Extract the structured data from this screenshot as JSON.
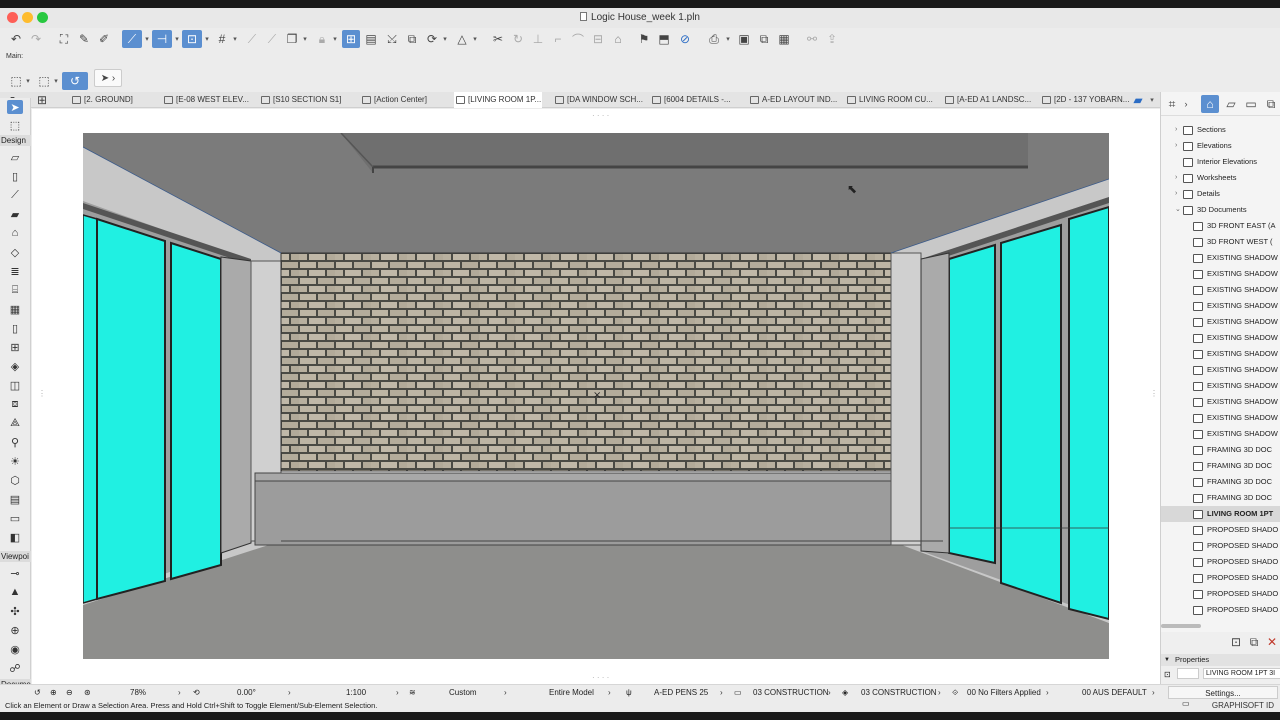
{
  "window": {
    "title": "Logic House_week 1.pln"
  },
  "colors": {
    "active_blue": "#5b8fd0",
    "glass": "#20f0e2",
    "ceiling": "#7b7b7b",
    "floor": "#8e8e8c",
    "brick": "#b8b0a0"
  },
  "main_label": "Main:",
  "tabs": [
    {
      "label": "[2. GROUND]"
    },
    {
      "label": "[E-08 WEST ELEV..."
    },
    {
      "label": "[S10 SECTION S1]"
    },
    {
      "label": "[Action Center]"
    },
    {
      "label": "[LIVING ROOM 1P..."
    },
    {
      "label": "[DA WINDOW SCH..."
    },
    {
      "label": "[6004 DETAILS -..."
    },
    {
      "label": "A-ED LAYOUT IND..."
    },
    {
      "label": "LIVING ROOM CU..."
    },
    {
      "label": "[A-ED A1 LANDSC..."
    },
    {
      "label": "[2D - 137 YOBARN..."
    }
  ],
  "toolbox": {
    "design_label": "Design",
    "viewpoint_label": "Viewpoi",
    "document_label": "Docume"
  },
  "navigator": {
    "items": [
      {
        "label": "Sections",
        "arrow": "›"
      },
      {
        "label": "Elevations",
        "arrow": "›"
      },
      {
        "label": "Interior Elevations",
        "arrow": ""
      },
      {
        "label": "Worksheets",
        "arrow": "›"
      },
      {
        "label": "Details",
        "arrow": "›"
      },
      {
        "label": "3D Documents",
        "arrow": "⌄"
      },
      {
        "label": "3D FRONT EAST (A"
      },
      {
        "label": "3D FRONT WEST ("
      },
      {
        "label": "EXISTING SHADOW"
      },
      {
        "label": "EXISTING SHADOW"
      },
      {
        "label": "EXISTING SHADOW"
      },
      {
        "label": "EXISTING SHADOW"
      },
      {
        "label": "EXISTING SHADOW"
      },
      {
        "label": "EXISTING SHADOW"
      },
      {
        "label": "EXISTING SHADOW"
      },
      {
        "label": "EXISTING SHADOW"
      },
      {
        "label": "EXISTING SHADOW"
      },
      {
        "label": "EXISTING SHADOW"
      },
      {
        "label": "EXISTING SHADOW"
      },
      {
        "label": "EXISTING SHADOW"
      },
      {
        "label": "FRAMING 3D DOC"
      },
      {
        "label": "FRAMING 3D DOC"
      },
      {
        "label": "FRAMING 3D DOC"
      },
      {
        "label": "FRAMING 3D DOC"
      },
      {
        "label": "LIVING ROOM 1PT"
      },
      {
        "label": "PROPOSED SHADO"
      },
      {
        "label": "PROPOSED SHADO"
      },
      {
        "label": "PROPOSED SHADO"
      },
      {
        "label": "PROPOSED SHADO"
      },
      {
        "label": "PROPOSED SHADO"
      },
      {
        "label": "PROPOSED SHADO"
      }
    ]
  },
  "properties": {
    "header": "Properties",
    "name_value": "LIVING ROOM 1PT 3I",
    "settings_label": "Settings..."
  },
  "status": {
    "zoom": "78%",
    "angle": "0.00°",
    "scale": "1:100",
    "layer_combo": "Custom",
    "model_view": "Entire Model",
    "pen_set": "A-ED PENS 25",
    "mvo": "03 CONSTRUCTION",
    "graphic_override": "03 CONSTRUCTION",
    "renovation": "00 No Filters Applied",
    "dimension": "00 AUS DEFAULT"
  },
  "hint": "Click an Element or Draw a Selection Area. Press and Hold Ctrl+Shift to Toggle Element/Sub-Element Selection.",
  "brand": "GRAPHISOFT ID"
}
